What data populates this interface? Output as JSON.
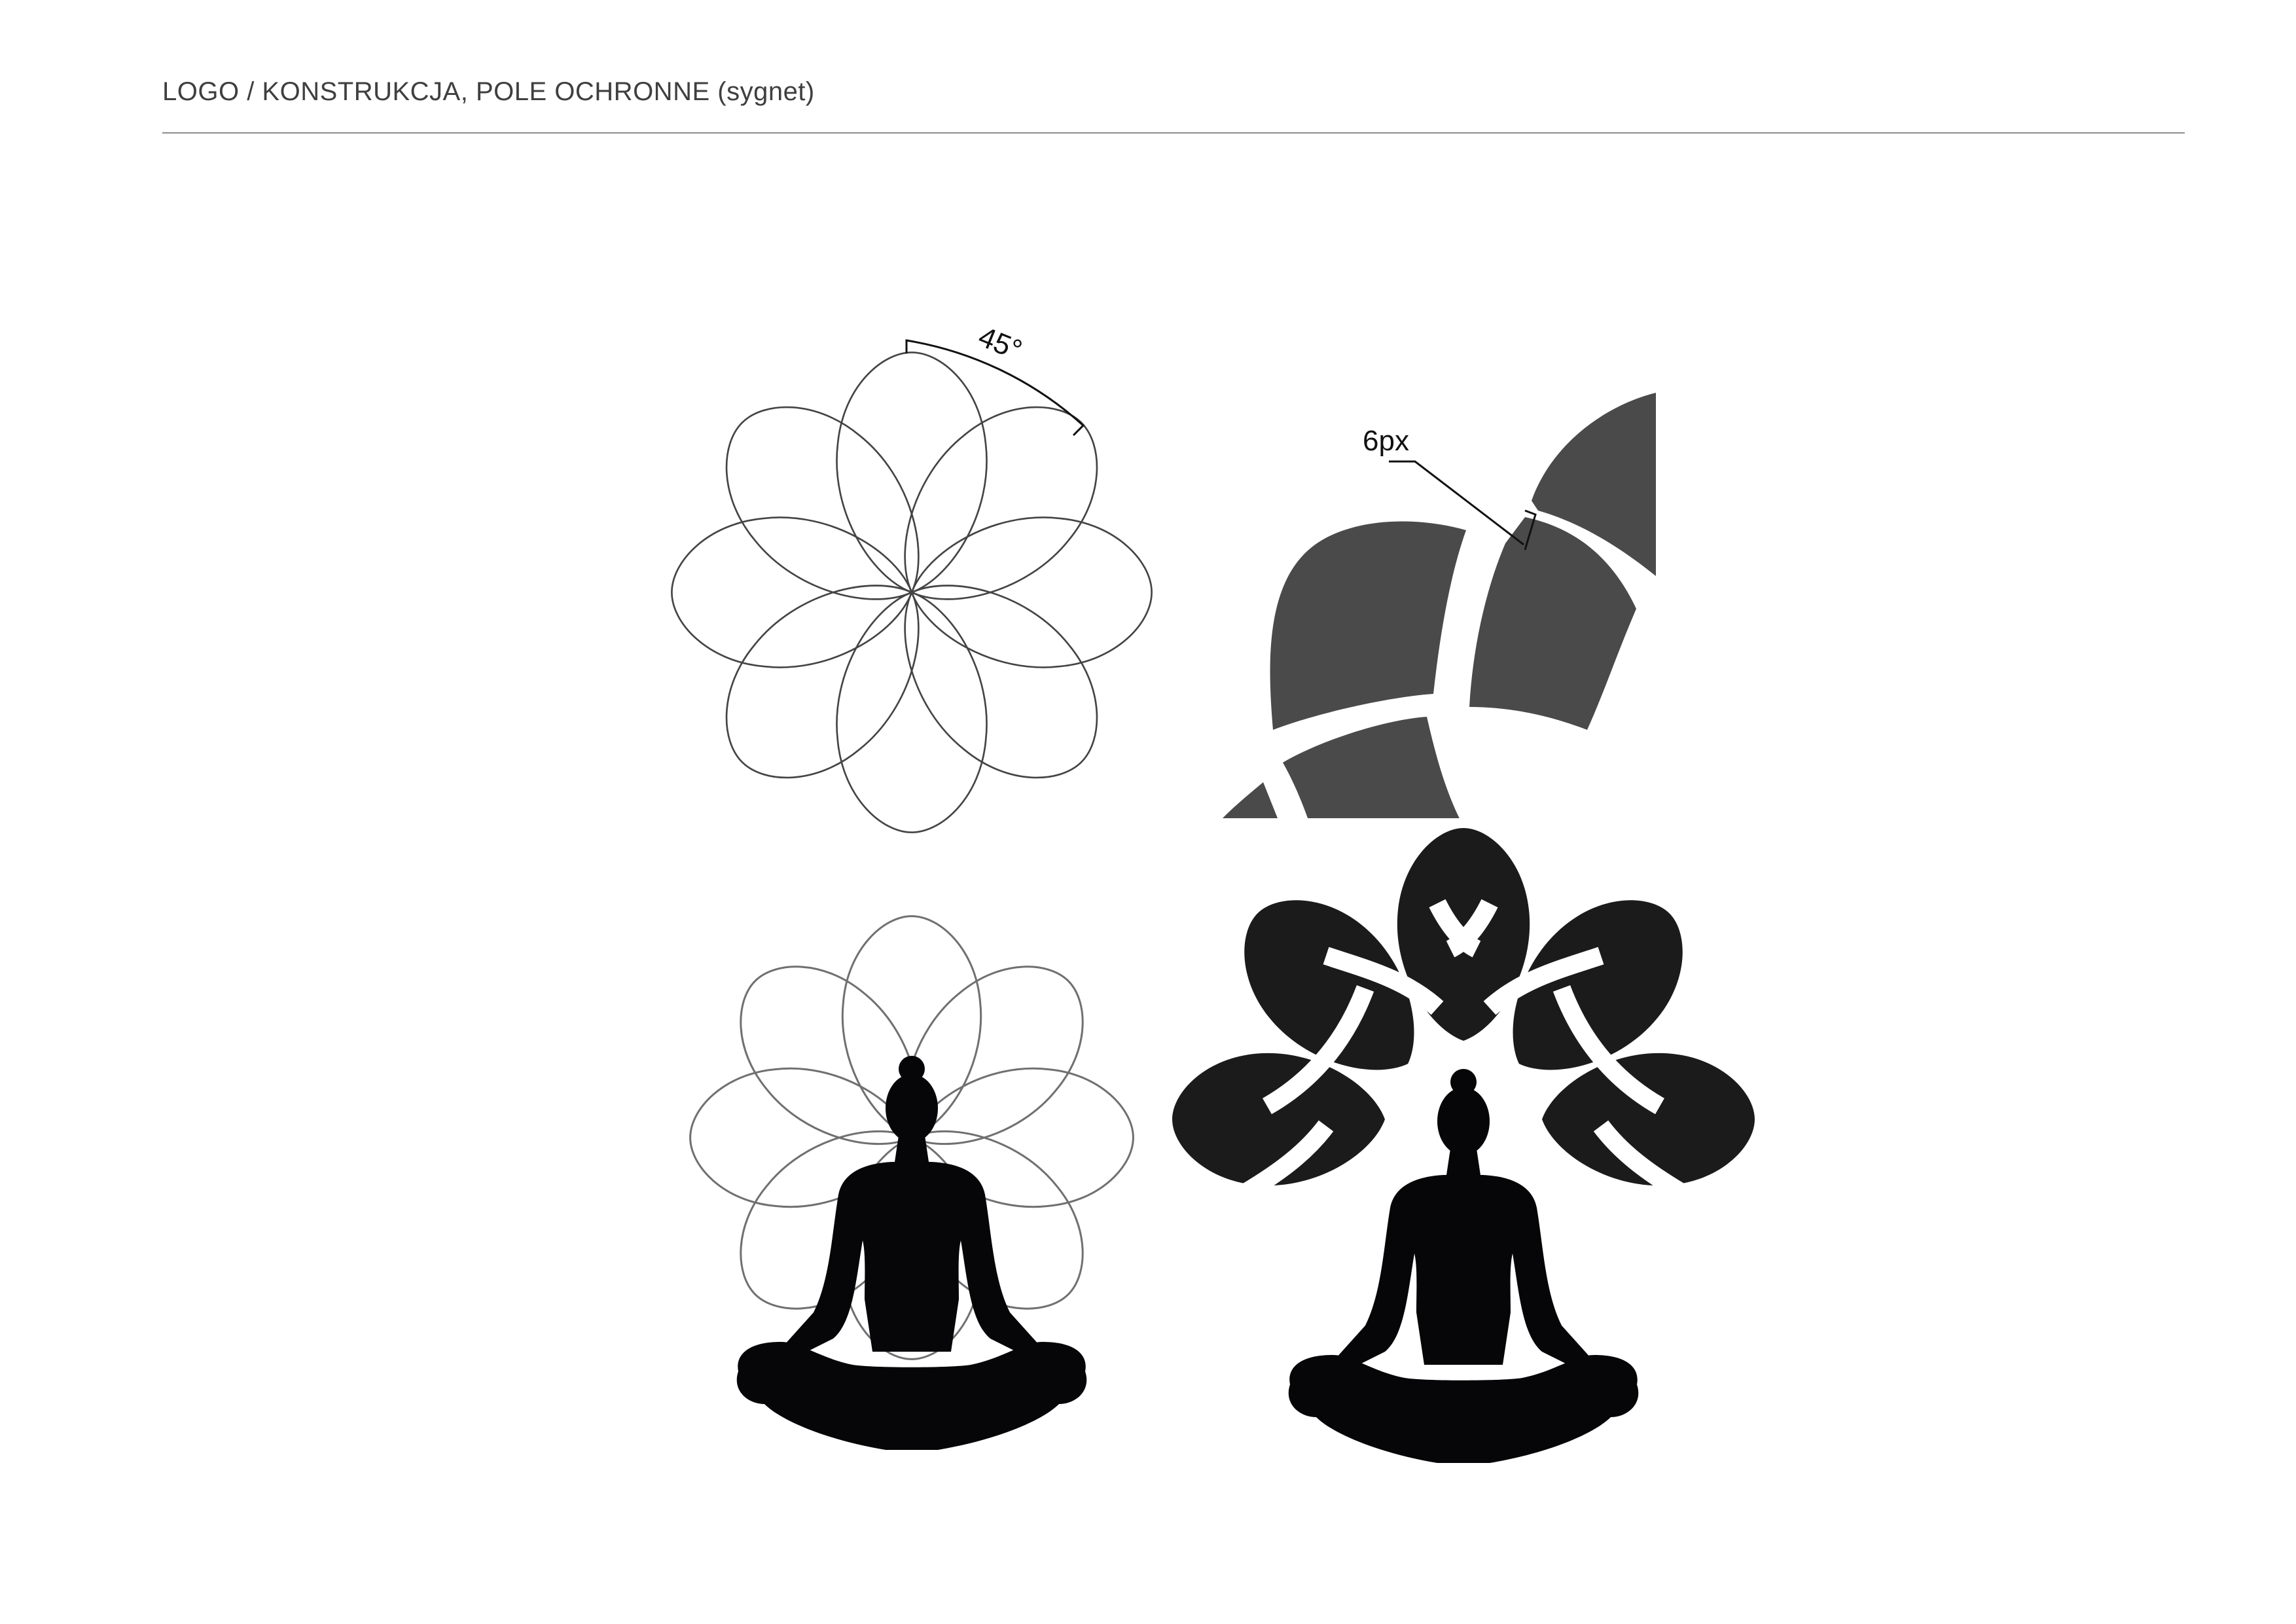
{
  "header": {
    "title": "LOGO / KONSTRUKCJA, POLE OCHRONNE (sygnet)"
  },
  "construction": {
    "angle_label": "45°",
    "gap_label": "6px",
    "petal_count": 8
  },
  "colors": {
    "outline": "#444444",
    "outline_light": "#707070",
    "petal_fill_gray": "#4a4a4a",
    "petal_fill_dark": "#1c1b1b",
    "silhouette": "#060608",
    "rule": "#8d8d8d"
  },
  "icons": {
    "flower_outline": "flower-construction-icon",
    "petal_detail": "petal-gap-detail-icon",
    "silhouette": "meditating-person-icon",
    "final_logo": "lotus-logo-icon"
  }
}
